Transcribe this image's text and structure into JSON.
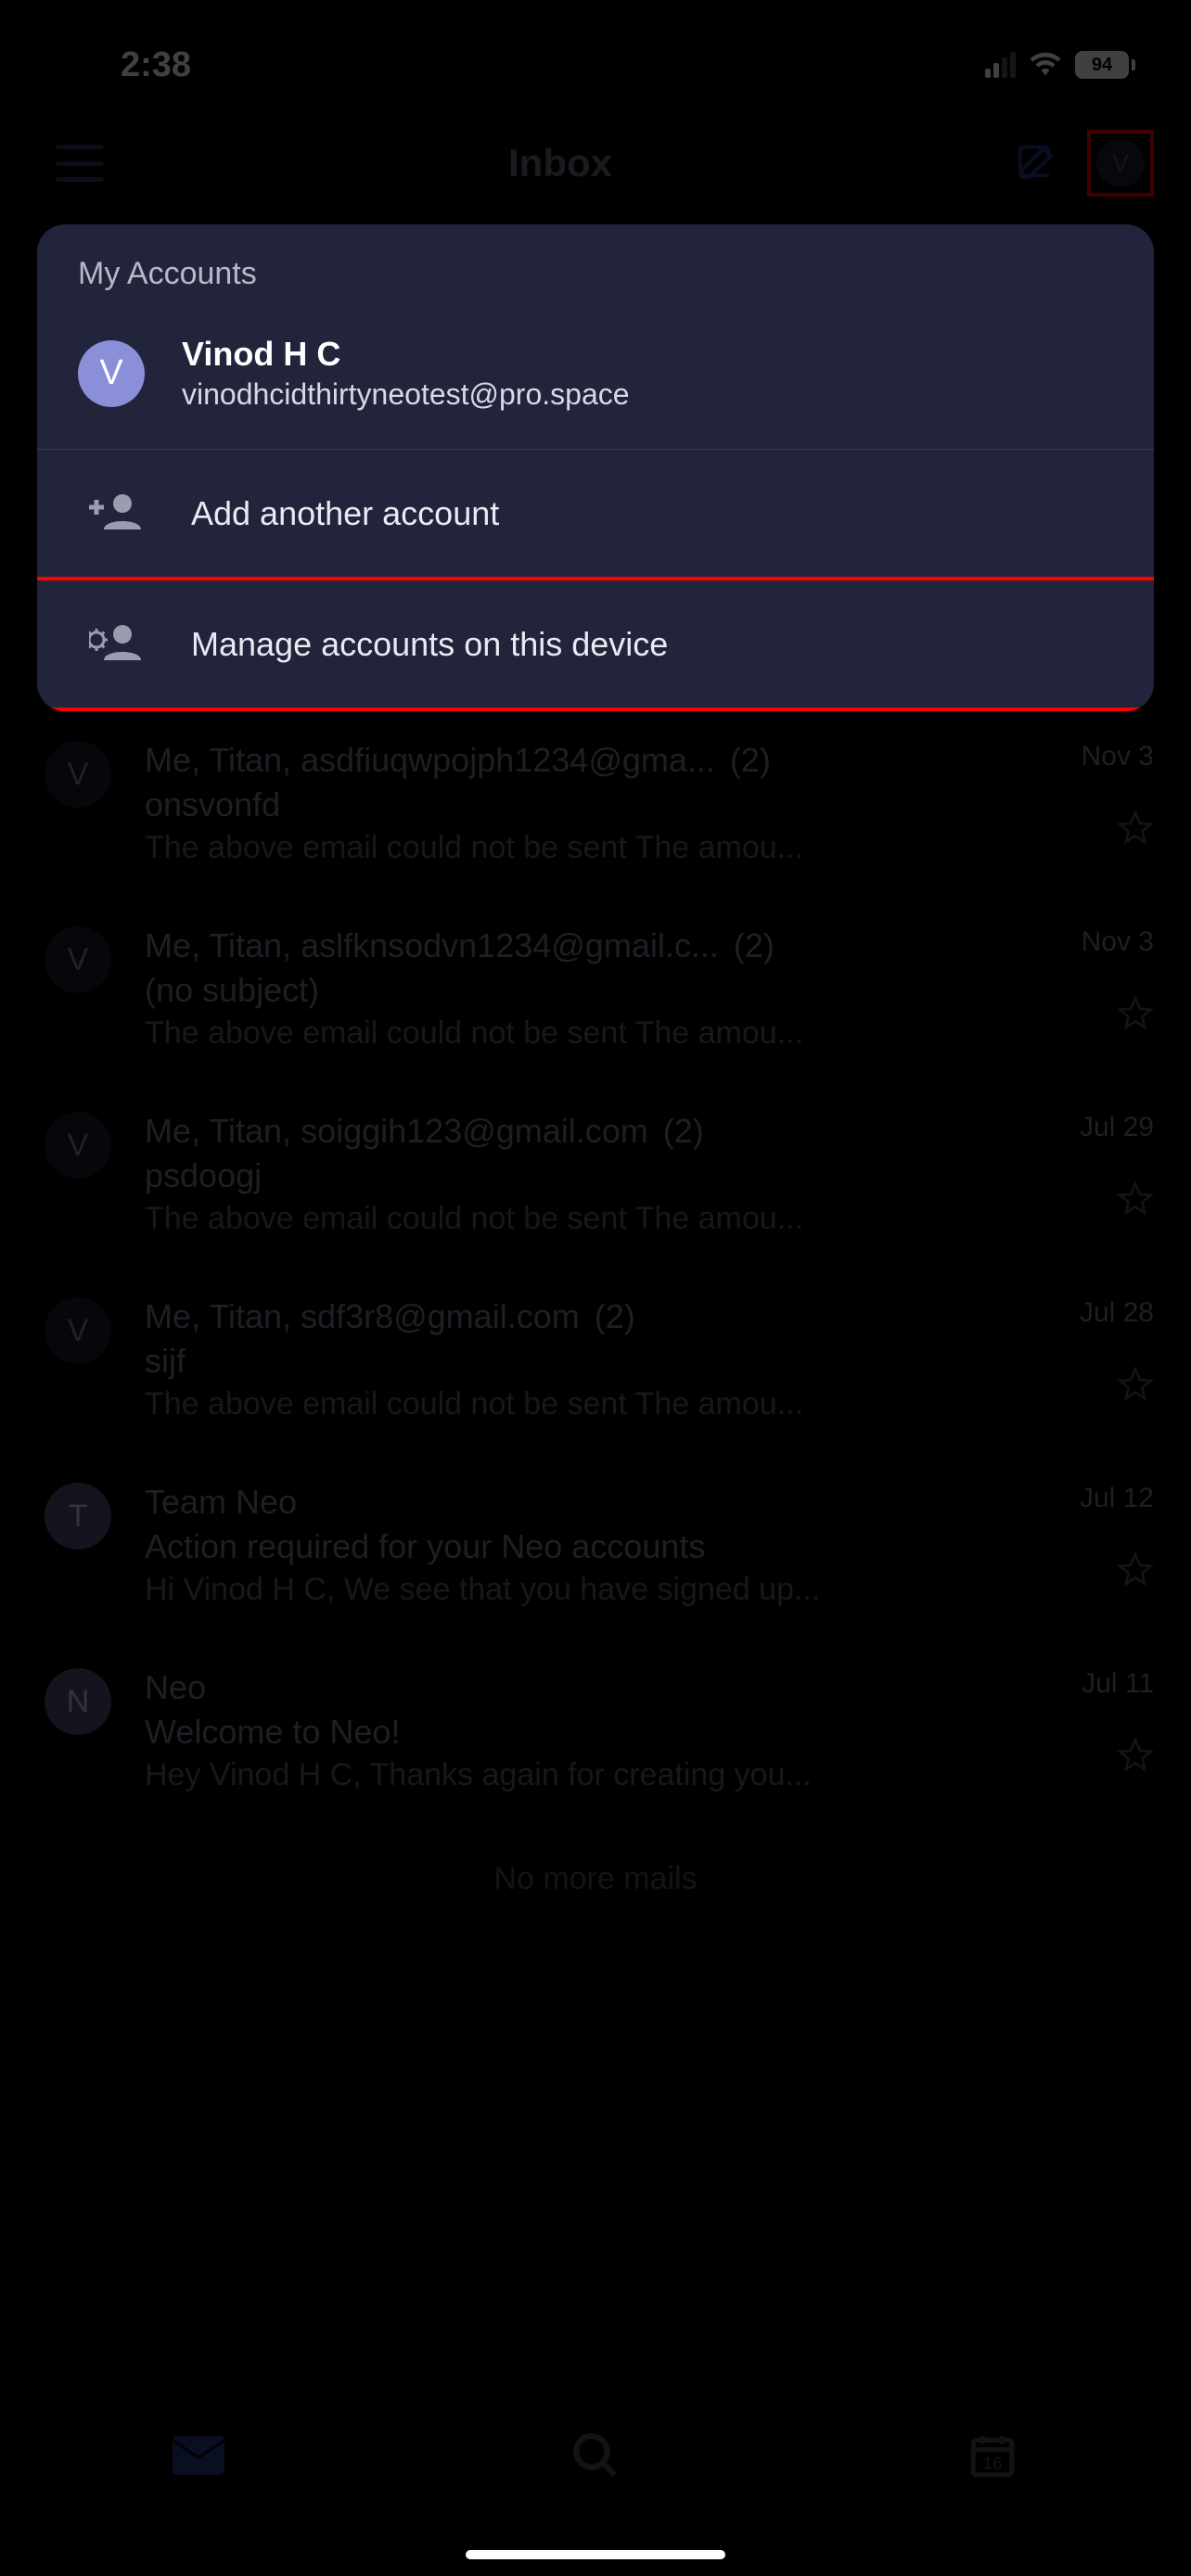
{
  "status": {
    "time": "2:38",
    "battery": "94"
  },
  "header": {
    "title": "Inbox",
    "avatar_letter": "V"
  },
  "panel": {
    "title": "My Accounts",
    "account": {
      "avatar_letter": "V",
      "name": "Vinod H C",
      "email": "vinodhcidthirtyneotest@pro.space"
    },
    "add_label": "Add another account",
    "manage_label": "Manage accounts on this device"
  },
  "emails": [
    {
      "avatar": "V",
      "avatar_class": "",
      "from": "Me, Titan, asdfiuqwpojph1234@gma...",
      "count": "(2)",
      "subject": "onsvonfd",
      "preview": "The above email could not be sent The amou...",
      "date": "Nov 3"
    },
    {
      "avatar": "V",
      "avatar_class": "",
      "from": "Me, Titan, aslfknsodvn1234@gmail.c...",
      "count": "(2)",
      "subject": "(no subject)",
      "preview": "The above email could not be sent The amou...",
      "date": "Nov 3"
    },
    {
      "avatar": "V",
      "avatar_class": "",
      "from": "Me, Titan, soiggih123@gmail.com",
      "count": "(2)",
      "subject": "psdoogj",
      "preview": "The above email could not be sent The amou...",
      "date": "Jul 29"
    },
    {
      "avatar": "V",
      "avatar_class": "",
      "from": "Me, Titan, sdf3r8@gmail.com",
      "count": "(2)",
      "subject": "sijf",
      "preview": "The above email could not be sent The amou...",
      "date": "Jul 28"
    },
    {
      "avatar": "T",
      "avatar_class": "purple",
      "from": "Team Neo",
      "count": "",
      "subject": "Action required for your Neo accounts",
      "preview": "Hi Vinod H C, We see that you have signed up...",
      "date": "Jul 12"
    },
    {
      "avatar": "N",
      "avatar_class": "purple",
      "from": "Neo",
      "count": "",
      "subject": "Welcome to Neo!",
      "preview": "Hey Vinod H C, Thanks again for creating you...",
      "date": "Jul 11"
    }
  ],
  "no_more": "No more mails",
  "calendar_day": "16"
}
